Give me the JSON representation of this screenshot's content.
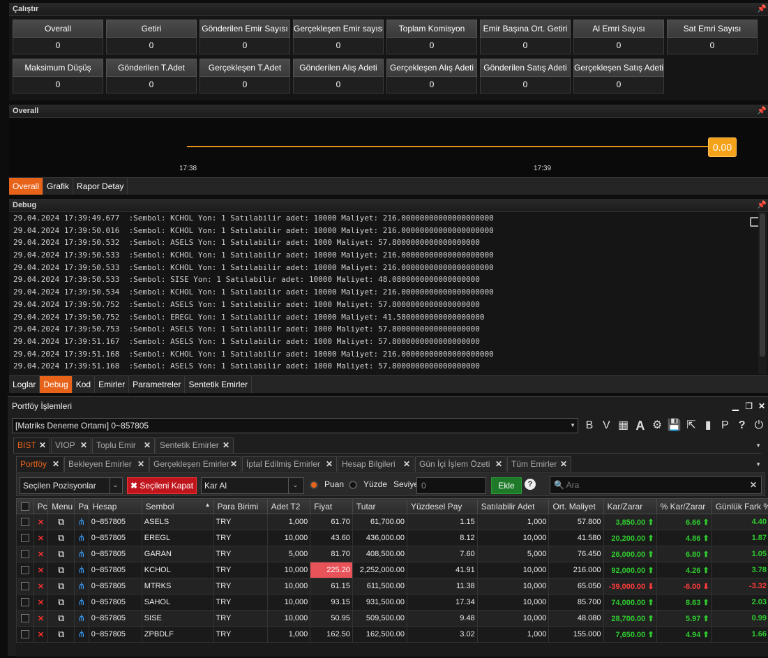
{
  "calistir": {
    "title": "Çalıştır",
    "row1": [
      {
        "label": "Overall",
        "value": "0"
      },
      {
        "label": "Getiri",
        "value": "0"
      },
      {
        "label": "Gönderilen Emir Sayısı",
        "value": "0"
      },
      {
        "label": "Gerçekleşen Emir sayısı",
        "value": "0"
      },
      {
        "label": "Toplam Komisyon",
        "value": "0"
      },
      {
        "label": "Emir Başına Ort. Getiri",
        "value": "0"
      },
      {
        "label": "Al Emri Sayısı",
        "value": "0"
      },
      {
        "label": "Sat Emri Sayısı",
        "value": "0"
      }
    ],
    "row2": [
      {
        "label": "Maksimum Düşüş",
        "value": "0"
      },
      {
        "label": "Gönderilen T.Adet",
        "value": "0"
      },
      {
        "label": "Gerçekleşen T.Adet",
        "value": "0"
      },
      {
        "label": "Gönderilen Alış Adeti",
        "value": "0"
      },
      {
        "label": "Gerçekleşen Alış Adeti",
        "value": "0"
      },
      {
        "label": "Gönderilen Satış Adeti",
        "value": "0"
      },
      {
        "label": "Gerçekleşen Satış Adeti",
        "value": "0"
      }
    ]
  },
  "overall": {
    "title": "Overall",
    "badge": "0.00",
    "time1": "17:38",
    "time2": "17:39",
    "line_color": "#e8921a",
    "tabs": [
      "Overall",
      "Grafik",
      "Rapor Detay"
    ]
  },
  "debug": {
    "title": "Debug",
    "lines": [
      "29.04.2024 17:39:49.677  :Sembol: KCHOL Yon: 1 Satılabilir adet: 10000 Maliyet: 216.00000000000000000000",
      "29.04.2024 17:39:50.016  :Sembol: KCHOL Yon: 1 Satılabilir adet: 10000 Maliyet: 216.00000000000000000000",
      "29.04.2024 17:39:50.532  :Sembol: ASELS Yon: 1 Satılabilir adet: 1000 Maliyet: 57.8000000000000000000",
      "29.04.2024 17:39:50.533  :Sembol: KCHOL Yon: 1 Satılabilir adet: 10000 Maliyet: 216.00000000000000000000",
      "29.04.2024 17:39:50.533  :Sembol: KCHOL Yon: 1 Satılabilir adet: 10000 Maliyet: 216.00000000000000000000",
      "29.04.2024 17:39:50.533  :Sembol: SISE Yon: 1 Satılabilir adet: 10000 Maliyet: 48.0800000000000000000",
      "29.04.2024 17:39:50.534  :Sembol: KCHOL Yon: 1 Satılabilir adet: 10000 Maliyet: 216.00000000000000000000",
      "29.04.2024 17:39:50.752  :Sembol: ASELS Yon: 1 Satılabilir adet: 1000 Maliyet: 57.8000000000000000000",
      "29.04.2024 17:39:50.752  :Sembol: EREGL Yon: 1 Satılabilir adet: 10000 Maliyet: 41.5800000000000000000",
      "29.04.2024 17:39:50.753  :Sembol: ASELS Yon: 1 Satılabilir adet: 1000 Maliyet: 57.8000000000000000000",
      "29.04.2024 17:39:51.167  :Sembol: ASELS Yon: 1 Satılabilir adet: 1000 Maliyet: 57.8000000000000000000",
      "29.04.2024 17:39:51.168  :Sembol: KCHOL Yon: 1 Satılabilir adet: 10000 Maliyet: 216.00000000000000000000",
      "29.04.2024 17:39:51.168  :Sembol: ASELS Yon: 1 Satılabilir adet: 1000 Maliyet: 57.8000000000000000000"
    ],
    "tabs": [
      "Loglar",
      "Debug",
      "Kod",
      "Emirler",
      "Parametreler",
      "Sentetik Emirler"
    ]
  },
  "portfoy": {
    "title": "Portföy İşlemleri",
    "account": "[Matriks Deneme Ortamı] 0~857805",
    "toolbar_icons": [
      "B",
      "V",
      "calculator-icon",
      "A",
      "gear-icon",
      "save-icon",
      "export-icon",
      "chart-icon",
      "P",
      "help-icon",
      "power-icon"
    ],
    "market_tabs": [
      "BIST",
      "VIOP",
      "Toplu Emir",
      "Sentetik Emirler"
    ],
    "sub_tabs": [
      "Portföy",
      "Bekleyen Emirler",
      "Gerçekleşen Emirler",
      "İptal Edilmiş Emirler",
      "Hesap Bilgileri",
      "Gün İçi İşlem Özeti",
      "Tüm Emirler"
    ],
    "filter": {
      "select": "Seçilen Pozisyonlar",
      "close_btn": "Seçileni Kapat",
      "type": "Kar Al",
      "radio1": "Puan",
      "radio2": "Yüzde",
      "level_label": "Seviye",
      "level_value": "0",
      "add_btn": "Ekle",
      "search_placeholder": "Ara"
    },
    "columns": [
      "",
      "Pc",
      "Menu",
      "Pa",
      "Hesap",
      "Sembol",
      "Para Birimi",
      "Adet T2",
      "Fiyat",
      "Tutar",
      "Yüzdesel Pay",
      "Satılabilir Adet",
      "Ort. Maliyet",
      "Kar/Zarar",
      "% Kar/Zarar",
      "Günlük Fark %"
    ],
    "rows": [
      {
        "hesap": "0~857805",
        "sembol": "ASELS",
        "para": "TRY",
        "adet": "1,000",
        "fiyat": "61.70",
        "tutar": "61,700.00",
        "pay": "1.15",
        "satilabilir": "1,000",
        "maliyet": "57.800",
        "kz": "3,850.00",
        "kzp": "6.66",
        "fark": "4.40",
        "neg": false,
        "hi": false
      },
      {
        "hesap": "0~857805",
        "sembol": "EREGL",
        "para": "TRY",
        "adet": "10,000",
        "fiyat": "43.60",
        "tutar": "436,000.00",
        "pay": "8.12",
        "satilabilir": "10,000",
        "maliyet": "41.580",
        "kz": "20,200.00",
        "kzp": "4.86",
        "fark": "1.87",
        "neg": false,
        "hi": false
      },
      {
        "hesap": "0~857805",
        "sembol": "GARAN",
        "para": "TRY",
        "adet": "5,000",
        "fiyat": "81.70",
        "tutar": "408,500.00",
        "pay": "7.60",
        "satilabilir": "5,000",
        "maliyet": "76.450",
        "kz": "26,000.00",
        "kzp": "6.80",
        "fark": "1.05",
        "neg": false,
        "hi": false
      },
      {
        "hesap": "0~857805",
        "sembol": "KCHOL",
        "para": "TRY",
        "adet": "10,000",
        "fiyat": "225.20",
        "tutar": "2,252,000.00",
        "pay": "41.91",
        "satilabilir": "10,000",
        "maliyet": "216.000",
        "kz": "92,000.00",
        "kzp": "4.26",
        "fark": "3.78",
        "neg": false,
        "hi": true
      },
      {
        "hesap": "0~857805",
        "sembol": "MTRKS",
        "para": "TRY",
        "adet": "10,000",
        "fiyat": "61.15",
        "tutar": "611,500.00",
        "pay": "11.38",
        "satilabilir": "10,000",
        "maliyet": "65.050",
        "kz": "-39,000.00",
        "kzp": "-6.00",
        "fark": "-3.32",
        "neg": true,
        "hi": false
      },
      {
        "hesap": "0~857805",
        "sembol": "SAHOL",
        "para": "TRY",
        "adet": "10,000",
        "fiyat": "93.15",
        "tutar": "931,500.00",
        "pay": "17.34",
        "satilabilir": "10,000",
        "maliyet": "85.700",
        "kz": "74,000.00",
        "kzp": "8.63",
        "fark": "2.03",
        "neg": false,
        "hi": false
      },
      {
        "hesap": "0~857805",
        "sembol": "SISE",
        "para": "TRY",
        "adet": "10,000",
        "fiyat": "50.95",
        "tutar": "509,500.00",
        "pay": "9.48",
        "satilabilir": "10,000",
        "maliyet": "48.080",
        "kz": "28,700.00",
        "kzp": "5.97",
        "fark": "0.99",
        "neg": false,
        "hi": false
      },
      {
        "hesap": "0~857805",
        "sembol": "ZPBDLF",
        "para": "TRY",
        "adet": "1,000",
        "fiyat": "162.50",
        "tutar": "162,500.00",
        "pay": "3.02",
        "satilabilir": "1,000",
        "maliyet": "155.000",
        "kz": "7,650.00",
        "kzp": "4.94",
        "fark": "1.66",
        "neg": false,
        "hi": false
      }
    ]
  }
}
